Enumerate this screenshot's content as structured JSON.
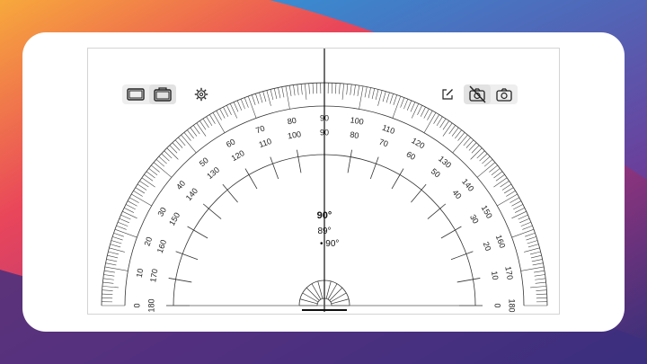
{
  "background": {
    "colors": [
      "#f39b3f",
      "#e8435a",
      "#b8347a",
      "#3d2f7e",
      "#2d89d4"
    ]
  },
  "toolbar_left": {
    "icons": [
      "landscape-frame-icon",
      "portrait-frame-icon"
    ],
    "settings_icon": "gear-icon"
  },
  "toolbar_right": {
    "icons": [
      "edit-icon",
      "camera-off-icon",
      "camera-icon"
    ]
  },
  "protractor": {
    "outer_labels": [
      "0",
      "10",
      "20",
      "30",
      "40",
      "50",
      "60",
      "70",
      "80",
      "90",
      "100",
      "110",
      "120",
      "130",
      "140",
      "150",
      "160",
      "170",
      "180"
    ],
    "inner_labels": [
      "180",
      "170",
      "160",
      "150",
      "140",
      "130",
      "120",
      "110",
      "100",
      "90",
      "80",
      "70",
      "60",
      "50",
      "40",
      "30",
      "20",
      "10",
      "0"
    ],
    "needle_angle": 90
  },
  "readout": {
    "main": "90°",
    "secondary": "89°",
    "tertiary": "90°"
  }
}
